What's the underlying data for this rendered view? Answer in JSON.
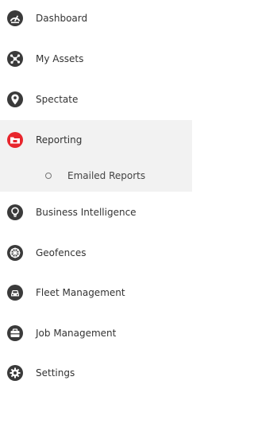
{
  "sidebar": {
    "items": [
      {
        "label": "Dashboard",
        "icon": "dashboard-gauge-icon"
      },
      {
        "label": "My Assets",
        "icon": "assets-network-icon"
      },
      {
        "label": "Spectate",
        "icon": "map-pin-icon"
      },
      {
        "label": "Reporting",
        "icon": "reports-folder-icon",
        "active": true,
        "submenu": [
          {
            "label": "Emailed Reports"
          }
        ]
      },
      {
        "label": "Business Intelligence",
        "icon": "lightbulb-icon"
      },
      {
        "label": "Geofences",
        "icon": "geofence-wheel-icon"
      },
      {
        "label": "Fleet Management",
        "icon": "car-icon"
      },
      {
        "label": "Job Management",
        "icon": "briefcase-icon"
      },
      {
        "label": "Settings",
        "icon": "gear-icon"
      }
    ]
  },
  "colors": {
    "icon_dark": "#3a3a3a",
    "active_icon": "#e8262d",
    "active_background": "#f2f2f2"
  }
}
